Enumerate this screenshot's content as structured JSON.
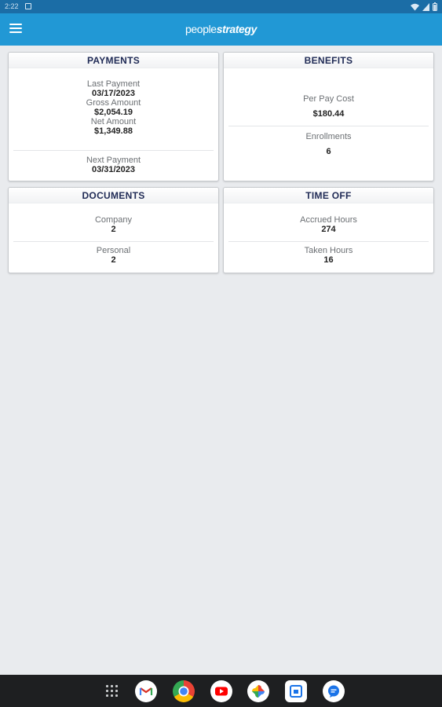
{
  "status_bar": {
    "time": "2:22"
  },
  "app": {
    "logo_part1": "people",
    "logo_part2": "strategy",
    "brand_color": "#2198d5"
  },
  "payments": {
    "title": "PAYMENTS",
    "last_payment_label": "Last Payment",
    "last_payment_value": "03/17/2023",
    "gross_amount_label": "Gross Amount",
    "gross_amount_value": "$2,054.19",
    "net_amount_label": "Net Amount",
    "net_amount_value": "$1,349.88",
    "next_payment_label": "Next Payment",
    "next_payment_value": "03/31/2023"
  },
  "benefits": {
    "title": "BENEFITS",
    "per_pay_cost_label": "Per Pay Cost",
    "per_pay_cost_value": "$180.44",
    "enrollments_label": "Enrollments",
    "enrollments_value": "6"
  },
  "documents": {
    "title": "DOCUMENTS",
    "company_label": "Company",
    "company_value": "2",
    "personal_label": "Personal",
    "personal_value": "2"
  },
  "time_off": {
    "title": "TIME OFF",
    "accrued_label": "Accrued Hours",
    "accrued_value": "274",
    "taken_label": "Taken Hours",
    "taken_value": "16"
  },
  "nav_bar": {
    "apps": [
      "app-drawer-icon",
      "gmail-icon",
      "chrome-icon",
      "youtube-icon",
      "photos-icon",
      "files-icon",
      "messages-icon"
    ]
  }
}
